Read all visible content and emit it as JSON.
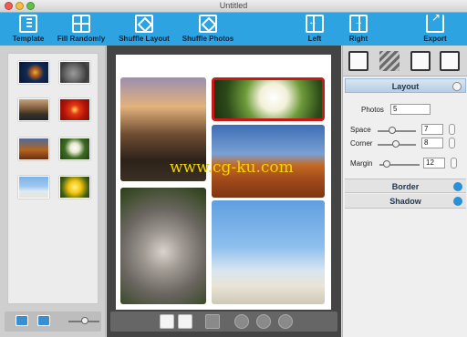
{
  "window": {
    "title": "Untitled"
  },
  "toolbar": {
    "template": "Template",
    "fill_randomly": "Fill Randomly",
    "shuffle_layout": "Shuffle Layout",
    "shuffle_photos": "Shuffle Photos",
    "left": "Left",
    "right": "Right",
    "export": "Export"
  },
  "layout_panel": {
    "title": "Layout",
    "photos_label": "Photos",
    "photos_value": "5",
    "space_label": "Space",
    "space_value": "7",
    "corner_label": "Corner",
    "corner_value": "8",
    "margin_label": "Margin",
    "margin_value": "12"
  },
  "sections": {
    "border": "Border",
    "shadow": "Shadow"
  },
  "watermark": "www.cg-ku.com",
  "colors": {
    "toolbar": "#2ea3e1",
    "accent": "#2b8fd6"
  }
}
